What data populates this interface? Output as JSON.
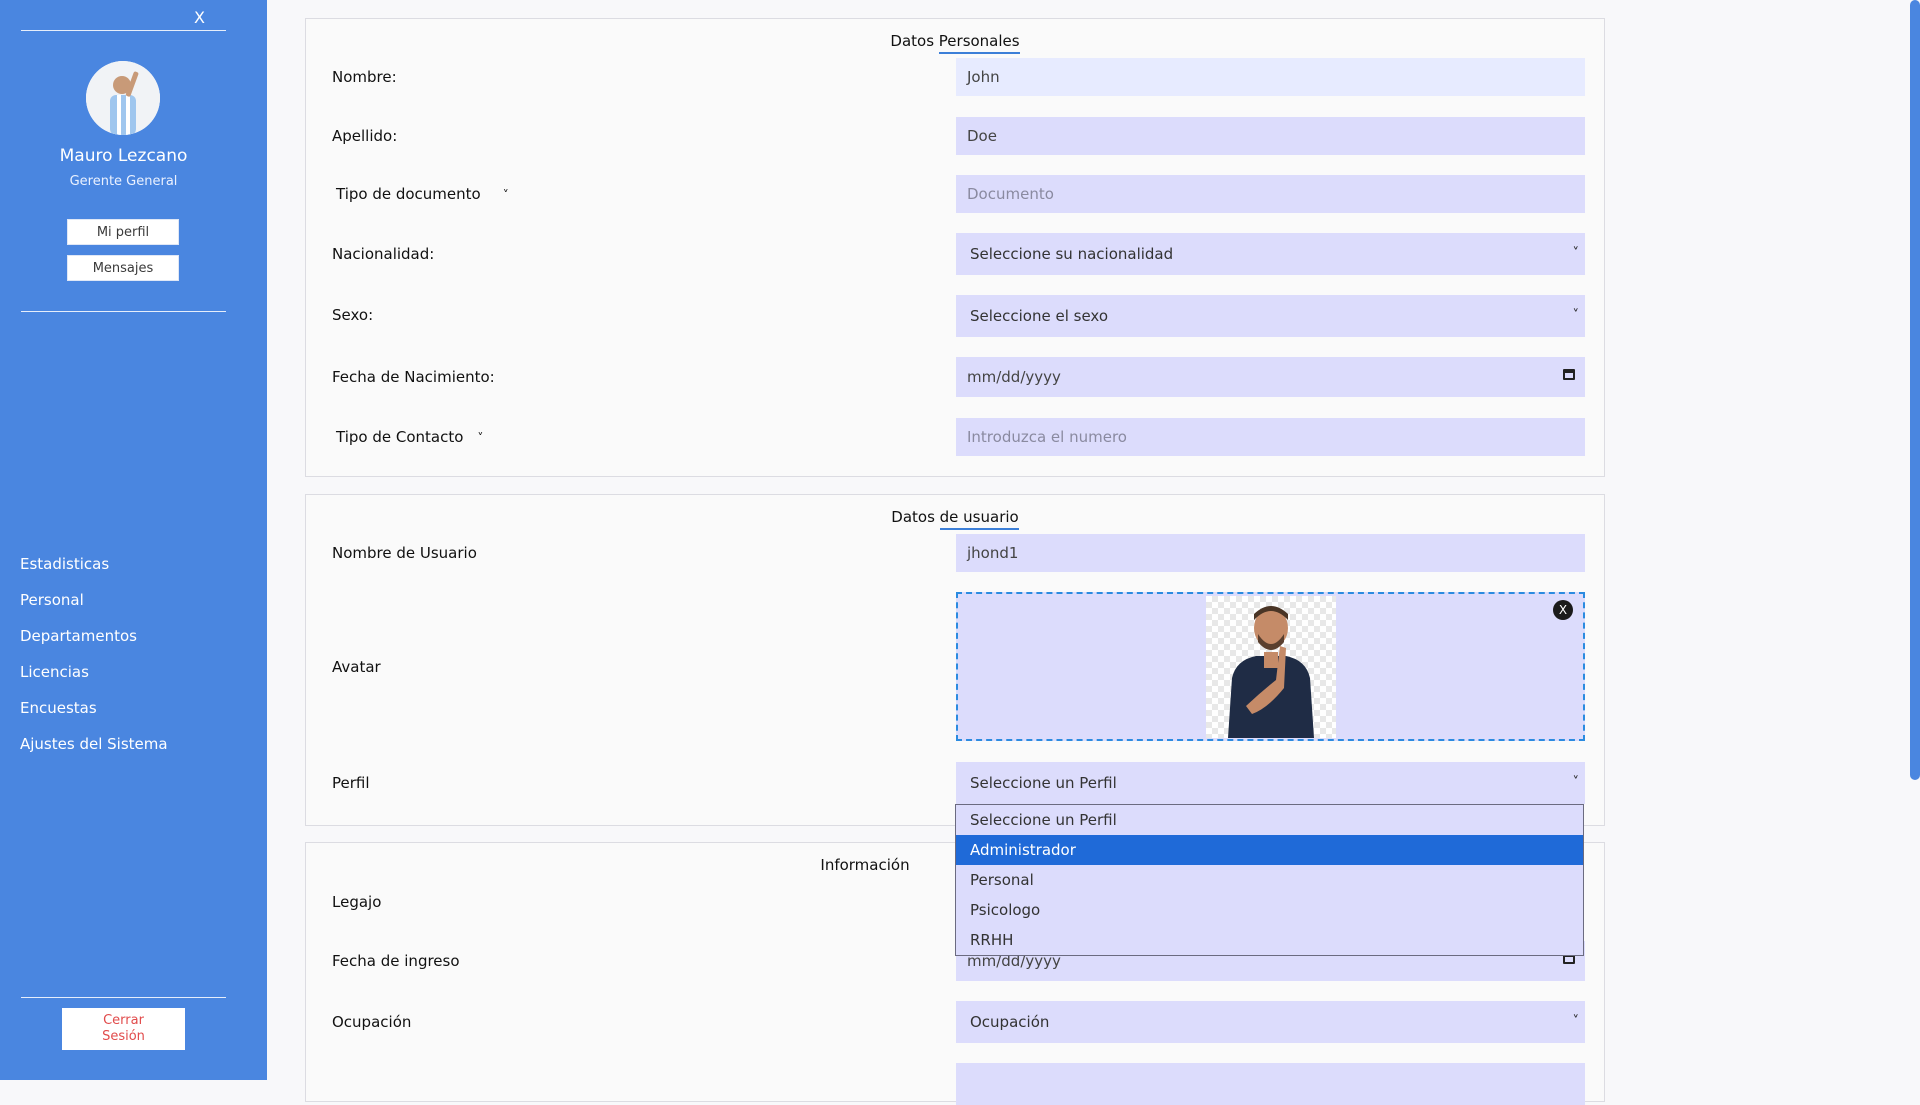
{
  "sidebar": {
    "close_label": "X",
    "user_name": "Mauro Lezcano",
    "user_role": "Gerente General",
    "btn_profile": "Mi perfil",
    "btn_messages": "Mensajes",
    "nav": [
      "Estadisticas",
      "Personal",
      "Departamentos",
      "Licencias",
      "Encuestas",
      "Ajustes del Sistema"
    ],
    "logout": "Cerrar Sesión"
  },
  "personal": {
    "title_a": "Datos ",
    "title_b": "Personales",
    "nombre_label": "Nombre:",
    "nombre_value": "John",
    "apellido_label": "Apellido:",
    "apellido_value": "Doe",
    "tipo_doc_label": "Tipo de documento",
    "documento_placeholder": "Documento",
    "nacionalidad_label": "Nacionalidad:",
    "nacionalidad_value": "Seleccione su nacionalidad",
    "sexo_label": "Sexo:",
    "sexo_value": "Seleccione el sexo",
    "fecha_label": "Fecha de Nacimiento:",
    "fecha_value": "mm/dd/yyyy",
    "contacto_label": "Tipo de Contacto",
    "contacto_placeholder": "Introduzca el numero"
  },
  "usuario": {
    "title_a": "Datos ",
    "title_b": "de usuario",
    "username_label": "Nombre de Usuario",
    "username_value": "jhond1",
    "avatar_label": "Avatar",
    "remove_label": "X",
    "perfil_label": "Perfil",
    "perfil_value": "Seleccione un Perfil",
    "perfil_options": [
      "Seleccione un Perfil",
      "Administrador",
      "Personal",
      "Psicologo",
      "RRHH"
    ]
  },
  "laboral": {
    "title": "Información",
    "legajo_label": "Legajo",
    "ingreso_label": "Fecha de ingreso",
    "ingreso_value": "mm/dd/yyyy",
    "ocupacion_label": "Ocupación",
    "ocupacion_value": "Ocupación"
  }
}
